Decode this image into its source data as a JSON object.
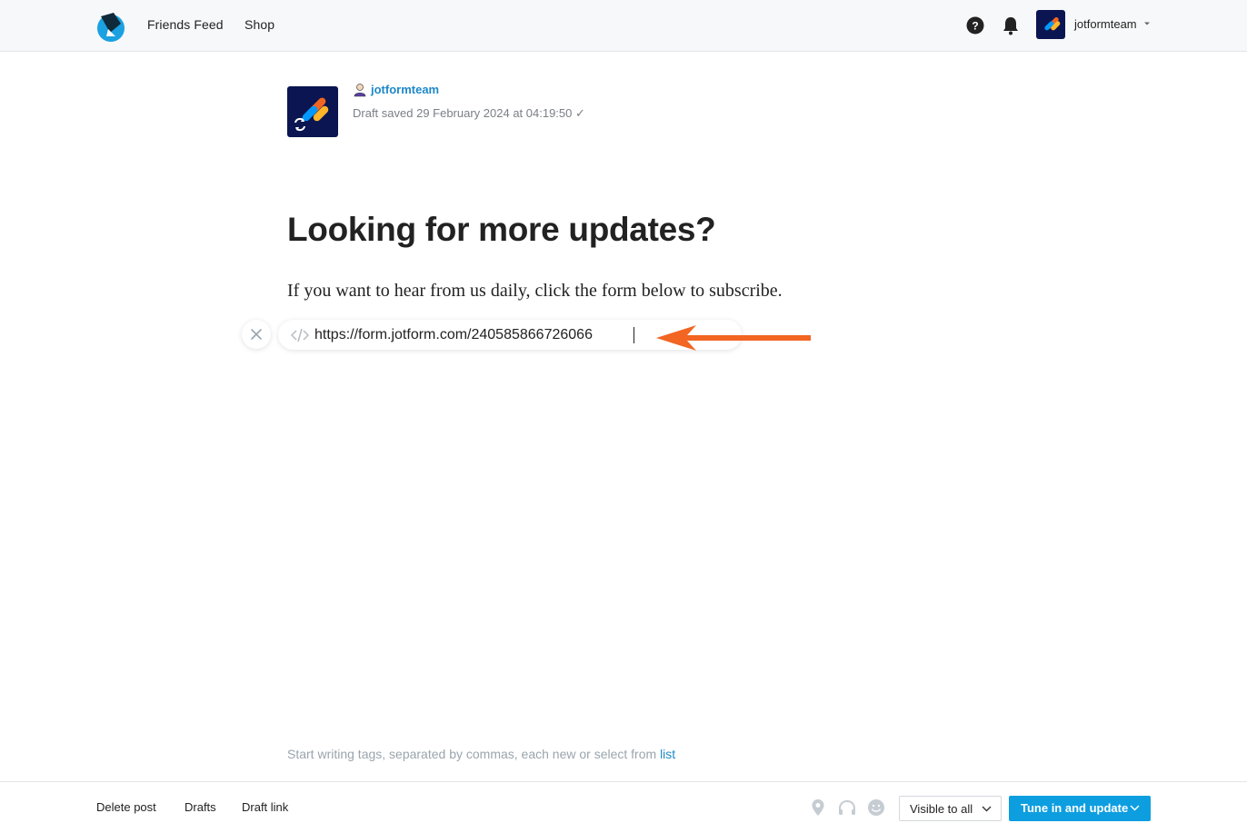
{
  "header": {
    "nav": [
      {
        "label": "Friends Feed"
      },
      {
        "label": "Shop"
      }
    ],
    "user": {
      "name": "jotformteam"
    }
  },
  "post": {
    "author": "jotformteam",
    "draft_status": "Draft saved 29 February 2024 at 04:19:50 ✓",
    "title": "Looking for more updates?",
    "body": "If you want to hear from us daily, click the form below to subscribe.",
    "embed_url": "https://form.jotform.com/240585866726066"
  },
  "tags": {
    "hint": "Start writing tags, separated by commas, each new or select from ",
    "link": "list"
  },
  "footer": {
    "delete": "Delete post",
    "drafts": "Drafts",
    "draft_link": "Draft link",
    "visibility": "Visible to all",
    "publish": "Tune in and update"
  },
  "colors": {
    "accent": "#0d9ee0",
    "link": "#1e88c9",
    "annotation_arrow": "#f26522",
    "brand_navy": "#0a1551"
  },
  "icons": [
    "logo-icon",
    "help-icon",
    "bell-icon",
    "close-icon",
    "code-icon",
    "location-pin-icon",
    "headphones-icon",
    "smile-icon",
    "chevron-down-icon"
  ]
}
